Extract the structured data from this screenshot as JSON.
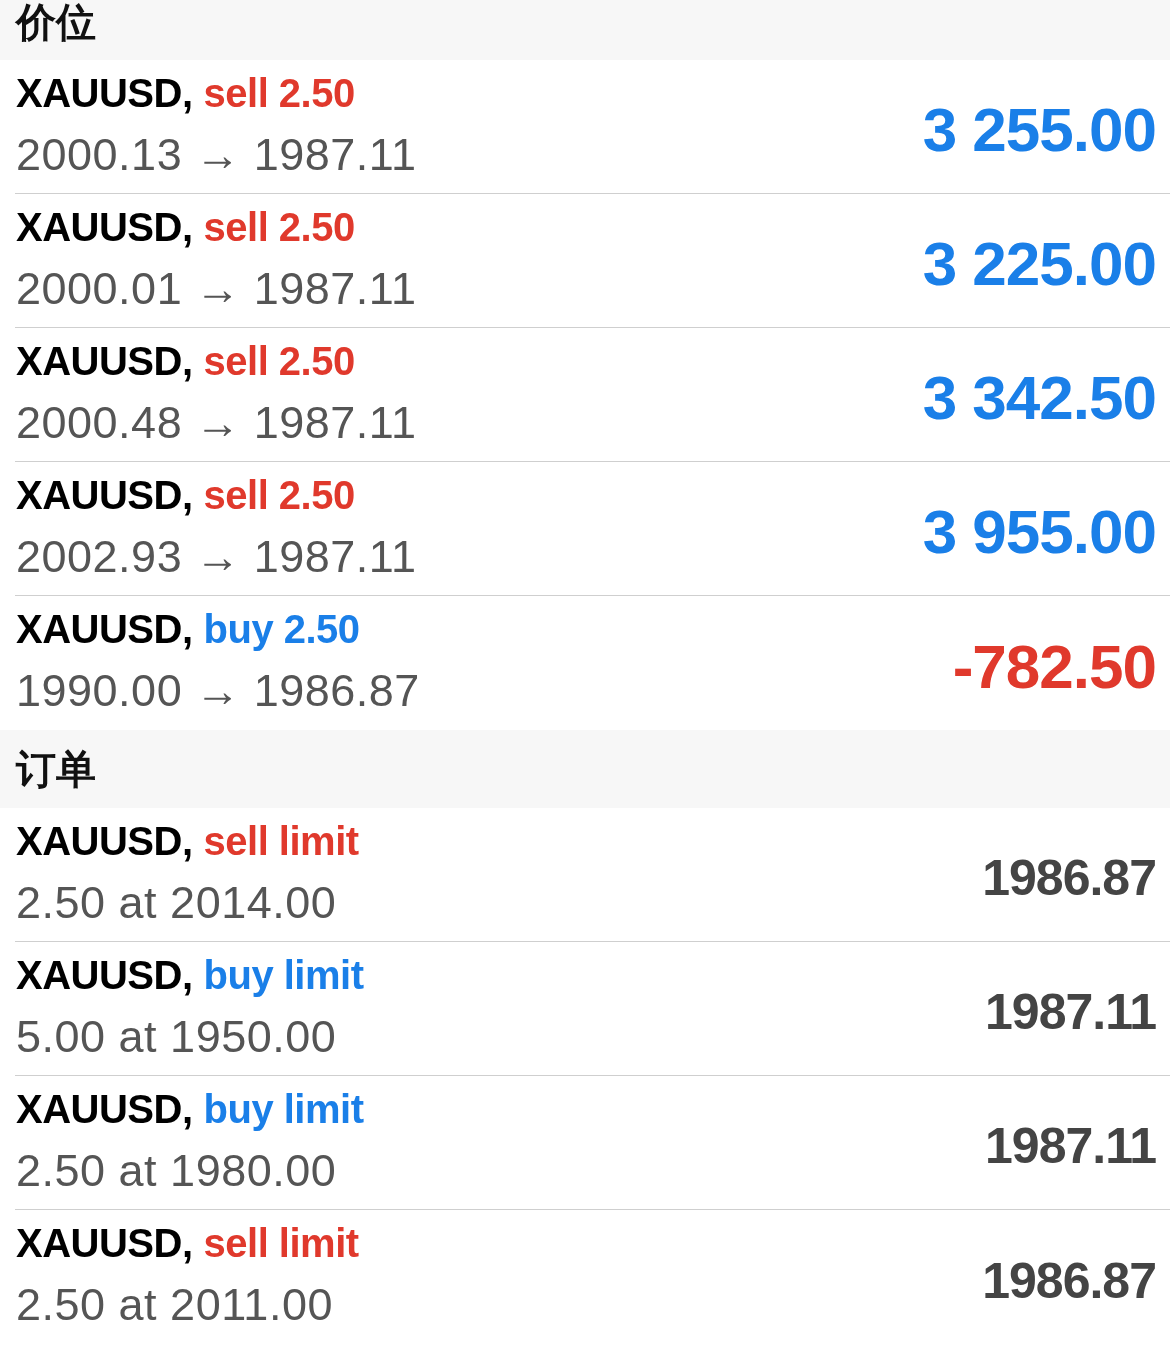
{
  "sections": [
    {
      "title": "价位",
      "items": [
        {
          "symbol": "XAUUSD,",
          "action": {
            "kind": "sell",
            "text": "sell 2.50"
          },
          "detail": "2000.13 → 1987.11",
          "value": {
            "kind": "profit",
            "text": "3 255.00"
          }
        },
        {
          "symbol": "XAUUSD,",
          "action": {
            "kind": "sell",
            "text": "sell 2.50"
          },
          "detail": "2000.01 → 1987.11",
          "value": {
            "kind": "profit",
            "text": "3 225.00"
          }
        },
        {
          "symbol": "XAUUSD,",
          "action": {
            "kind": "sell",
            "text": "sell 2.50"
          },
          "detail": "2000.48 → 1987.11",
          "value": {
            "kind": "profit",
            "text": "3 342.50"
          }
        },
        {
          "symbol": "XAUUSD,",
          "action": {
            "kind": "sell",
            "text": "sell 2.50"
          },
          "detail": "2002.93 → 1987.11",
          "value": {
            "kind": "profit",
            "text": "3 955.00"
          }
        },
        {
          "symbol": "XAUUSD,",
          "action": {
            "kind": "buy",
            "text": "buy 2.50"
          },
          "detail": "1990.00 → 1986.87",
          "value": {
            "kind": "loss",
            "text": "-782.50"
          }
        }
      ]
    },
    {
      "title": "订单",
      "items": [
        {
          "symbol": "XAUUSD,",
          "action": {
            "kind": "sell",
            "text": "sell limit"
          },
          "detail": "2.50 at 2014.00",
          "value": {
            "kind": "price",
            "text": "1986.87"
          }
        },
        {
          "symbol": "XAUUSD,",
          "action": {
            "kind": "buy",
            "text": "buy limit"
          },
          "detail": "5.00 at 1950.00",
          "value": {
            "kind": "price",
            "text": "1987.11"
          }
        },
        {
          "symbol": "XAUUSD,",
          "action": {
            "kind": "buy",
            "text": "buy limit"
          },
          "detail": "2.50 at 1980.00",
          "value": {
            "kind": "price",
            "text": "1987.11"
          }
        },
        {
          "symbol": "XAUUSD,",
          "action": {
            "kind": "sell",
            "text": "sell limit"
          },
          "detail": "2.50 at 2011.00",
          "value": {
            "kind": "price",
            "text": "1986.87"
          }
        }
      ]
    }
  ]
}
